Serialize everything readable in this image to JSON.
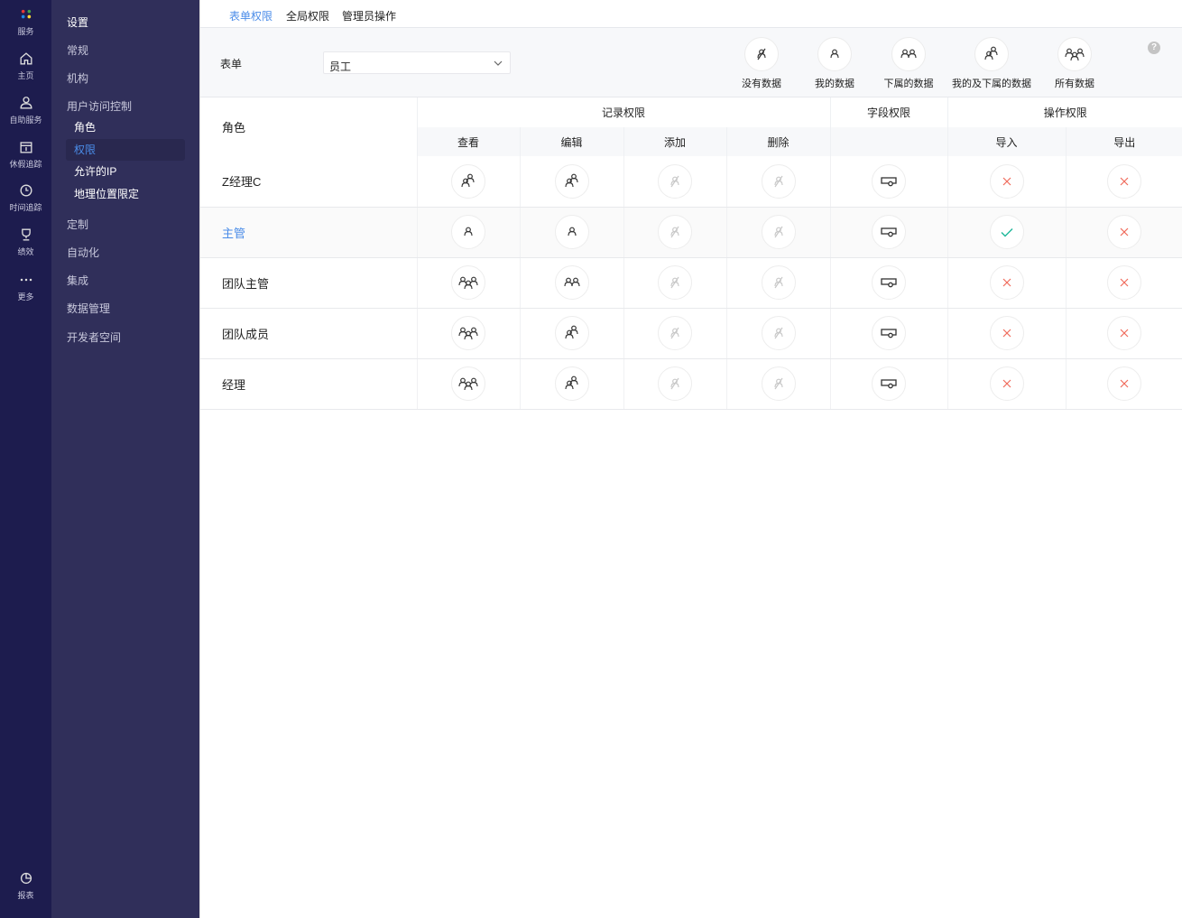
{
  "rail": [
    {
      "label": "服务",
      "icon": "apps-icon"
    },
    {
      "label": "主页",
      "icon": "home-icon"
    },
    {
      "label": "自助服务",
      "icon": "user-icon"
    },
    {
      "label": "休假追踪",
      "icon": "calendar-icon"
    },
    {
      "label": "时间追踪",
      "icon": "clock-icon"
    },
    {
      "label": "绩效",
      "icon": "trophy-icon"
    },
    {
      "label": "更多",
      "icon": "more-icon"
    },
    {
      "label": "报表",
      "icon": "report-icon"
    }
  ],
  "sidebar": {
    "title": "设置",
    "items": [
      "常规",
      "机构",
      "用户访问控制"
    ],
    "sub": [
      "角色",
      "权限",
      "允许的IP",
      "地理位置限定"
    ],
    "items2": [
      "定制",
      "自动化",
      "集成",
      "数据管理",
      "开发者空间"
    ]
  },
  "tabs": [
    "表单权限",
    "全局权限",
    "管理员操作"
  ],
  "filter": {
    "label": "表单",
    "value": "员工"
  },
  "legend": [
    {
      "label": "没有数据",
      "icon": "none"
    },
    {
      "label": "我的数据",
      "icon": "mine"
    },
    {
      "label": "下属的数据",
      "icon": "sub"
    },
    {
      "label": "我的及下属的数据",
      "icon": "minesub"
    },
    {
      "label": "所有数据",
      "icon": "all"
    }
  ],
  "help": "?",
  "table": {
    "role_header": "角色",
    "groups": [
      "记录权限",
      "字段权限",
      "操作权限"
    ],
    "columns": [
      "查看",
      "编辑",
      "添加",
      "删除",
      "",
      "导入",
      "导出"
    ],
    "rows": [
      {
        "role": "Z经理C",
        "cells": [
          "minesub",
          "minesub",
          "none",
          "none",
          "field",
          "cross",
          "cross"
        ]
      },
      {
        "role": "主管",
        "cells": [
          "mine",
          "mine",
          "none",
          "none",
          "field",
          "check",
          "cross"
        ]
      },
      {
        "role": "团队主管",
        "cells": [
          "all",
          "sub",
          "none",
          "none",
          "field",
          "cross",
          "cross"
        ]
      },
      {
        "role": "团队成员",
        "cells": [
          "all",
          "minesub",
          "none",
          "none",
          "field",
          "cross",
          "cross"
        ]
      },
      {
        "role": "经理",
        "cells": [
          "all",
          "minesub",
          "none",
          "none",
          "field",
          "cross",
          "cross"
        ]
      }
    ]
  },
  "colors": {
    "accent": "#4a8ce8",
    "cross": "#f06a5a",
    "check": "#1fb89a"
  }
}
